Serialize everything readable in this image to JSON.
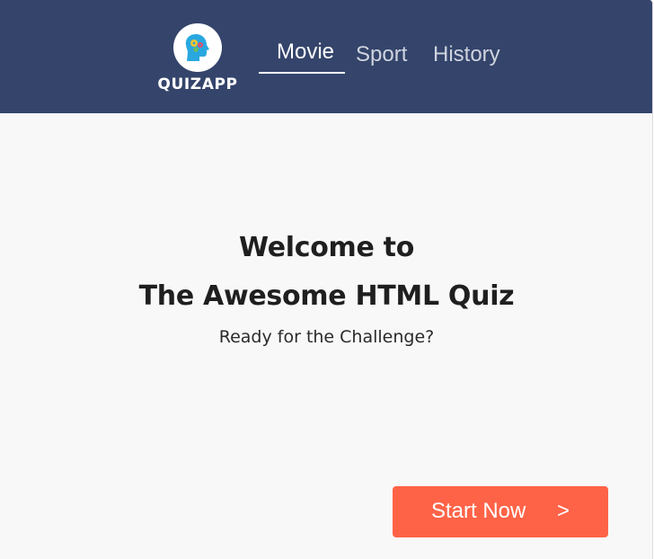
{
  "header": {
    "logo_text": "QUIZAPP",
    "logo_icon": "head-with-gears-icon",
    "tabs": [
      {
        "label": "Movie",
        "active": true
      },
      {
        "label": "Sport",
        "active": false
      },
      {
        "label": "History",
        "active": false
      }
    ]
  },
  "main": {
    "title_line1": "Welcome to",
    "title_line2": "The Awesome HTML Quiz",
    "subtitle": "Ready for the Challenge?"
  },
  "start_button": {
    "label": "Start Now",
    "arrow": ">"
  },
  "colors": {
    "header_bg": "#34446b",
    "page_bg": "#f8f8f8",
    "accent": "#ff6347",
    "logo_head": "#29a8e0"
  }
}
